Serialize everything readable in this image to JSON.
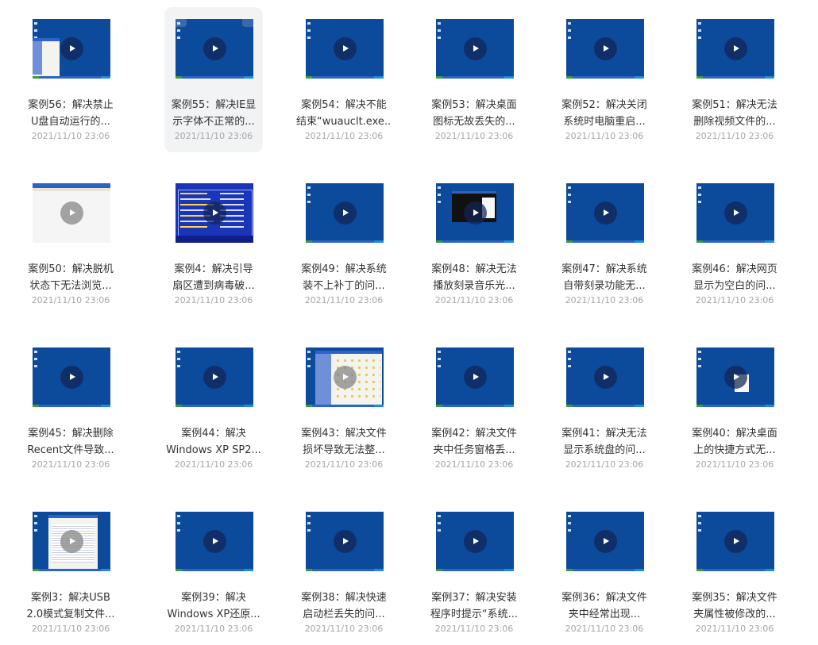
{
  "videos": [
    {
      "line1": "案例56：解决禁止",
      "line2": "U盘自动运行的...",
      "date": "2021/11/10 23:06"
    },
    {
      "line1": "案例55：解决IE显",
      "line2": "示字体不正常的...",
      "date": "2021/11/10 23:06"
    },
    {
      "line1": "案例54：解决不能",
      "line2": "结束“wuauclt.exe...",
      "date": "2021/11/10 23:06"
    },
    {
      "line1": "案例53：解决桌面",
      "line2": "图标无故丢失的...",
      "date": "2021/11/10 23:06"
    },
    {
      "line1": "案例52：解决关闭",
      "line2": "系统时电脑重启...",
      "date": "2021/11/10 23:06"
    },
    {
      "line1": "案例51：解决无法",
      "line2": "删除视频文件的...",
      "date": "2021/11/10 23:06"
    },
    {
      "line1": "案例50：解决脱机",
      "line2": "状态下无法浏览...",
      "date": "2021/11/10 23:06"
    },
    {
      "line1": "案例4：解决引导",
      "line2": "扇区遭到病毒破...",
      "date": "2021/11/10 23:06"
    },
    {
      "line1": "案例49：解决系统",
      "line2": "装不上补丁的问...",
      "date": "2021/11/10 23:06"
    },
    {
      "line1": "案例48：解决无法",
      "line2": "播放刻录音乐光...",
      "date": "2021/11/10 23:06"
    },
    {
      "line1": "案例47：解决系统",
      "line2": "自带刻录功能无...",
      "date": "2021/11/10 23:06"
    },
    {
      "line1": "案例46：解决网页",
      "line2": "显示为空白的问...",
      "date": "2021/11/10 23:06"
    },
    {
      "line1": "案例45：解决删除",
      "line2": "Recent文件导致...",
      "date": "2021/11/10 23:06"
    },
    {
      "line1": "案例44：解决",
      "line2": "Windows XP SP2...",
      "date": "2021/11/10 23:06"
    },
    {
      "line1": "案例43：解决文件",
      "line2": "损坏导致无法整...",
      "date": "2021/11/10 23:06"
    },
    {
      "line1": "案例42：解决文件",
      "line2": "夹中任务窗格丢...",
      "date": "2021/11/10 23:06"
    },
    {
      "line1": "案例41：解决无法",
      "line2": "显示系统盘的问...",
      "date": "2021/11/10 23:06"
    },
    {
      "line1": "案例40：解决桌面",
      "line2": "上的快捷方式无...",
      "date": "2021/11/10 23:06"
    },
    {
      "line1": "案例3：解决USB",
      "line2": "2.0模式复制文件...",
      "date": "2021/11/10 23:06"
    },
    {
      "line1": "案例39：解决",
      "line2": "Windows XP还原...",
      "date": "2021/11/10 23:06"
    },
    {
      "line1": "案例38：解决快速",
      "line2": "启动栏丢失的问...",
      "date": "2021/11/10 23:06"
    },
    {
      "line1": "案例37：解决安装",
      "line2": "程序时提示“系统...",
      "date": "2021/11/10 23:06"
    },
    {
      "line1": "案例36：解决文件",
      "line2": "夹中经常出现...",
      "date": "2021/11/10 23:06"
    },
    {
      "line1": "案例35：解决文件",
      "line2": "夹属性被修改的...",
      "date": "2021/11/10 23:06"
    }
  ],
  "hovered_index": 1,
  "icons": {
    "play": "play-icon",
    "thumbnail": "video-thumbnail"
  },
  "colors": {
    "thumb_blue": "#0c4a9c",
    "title": "#333333",
    "date": "#a6a6a6",
    "hover_bg": "#f2f3f5"
  }
}
